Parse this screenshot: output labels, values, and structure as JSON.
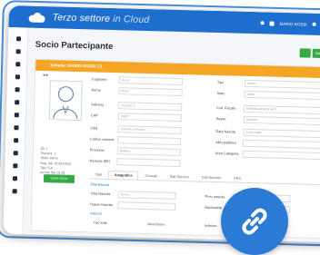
{
  "app": {
    "brand_main": "Terzo settore",
    "brand_sub": " in Cloud",
    "user_label": "MARIO ROSSI"
  },
  "page": {
    "title": "Socio Partecipante",
    "header_action_label": "Salva"
  },
  "card": {
    "title": "Scheda: MARIO ROSSI (7)",
    "fields": [
      {
        "label": "Cognome",
        "value": "Rossi"
      },
      {
        "label": "Nome",
        "value": "Mario"
      },
      {
        "label": "Indirizzo",
        "value": "Via Dati, 5"
      },
      {
        "label": "CAP",
        "value": "00027"
      },
      {
        "label": "Città",
        "value": "San Vito a Prazzo"
      },
      {
        "label": "Codice comune",
        "value": ""
      },
      {
        "label": "Provincia",
        "value": "Belluno"
      },
      {
        "label": "Nazione (EE)",
        "value": ""
      }
    ],
    "fields_right": [
      {
        "label": "Tipo",
        "value": "Valore"
      },
      {
        "label": "Stato",
        "value": "Attivo"
      },
      {
        "label": "Cod. Fiscale",
        "value": "RSSMRA00A01L407L"
      },
      {
        "label": "Sesso",
        "value": "Maschio"
      },
      {
        "label": "Data Nascita",
        "value": "01.01.1980"
      },
      {
        "label": "Albo pubblico",
        "value": ""
      },
      {
        "label": "Area Categoria",
        "value": ""
      }
    ],
    "side_info": [
      "ID: 7",
      "Tessera: 1",
      "Stato: Attivo",
      "Reg. dal: 01/01/2020",
      "Tipo S.A.:",
      "Iscritto dal: 01.01"
    ],
    "side_button": "Carta Socio"
  },
  "tabs": [
    "Dati",
    "Anagrafica",
    "Contatti",
    "Dati Servizio",
    "Dati Servizio",
    "Altro"
  ],
  "active_tab_index": 1,
  "sub_section": {
    "title": "Dati Nascita",
    "fields": [
      {
        "label": "Città Nascita",
        "value": "Roma"
      },
      {
        "label": "Prov. nascita",
        "value": ""
      },
      {
        "label": "Paese Nascita",
        "value": ""
      },
      {
        "label": "Nazionalità",
        "value": ""
      }
    ],
    "sub_title_2": "Indirizzi"
  },
  "table_headers": [
    "Tipo Indir.",
    "Descrizione",
    "Indirizzo"
  ],
  "icons": {
    "logo": "cloud-logo-icon",
    "link": "link-icon"
  },
  "colors": {
    "topbar": "#1e6fcd",
    "card_header": "#f5a524",
    "accent_green": "#36a844",
    "badge": "#2b7bd6"
  }
}
